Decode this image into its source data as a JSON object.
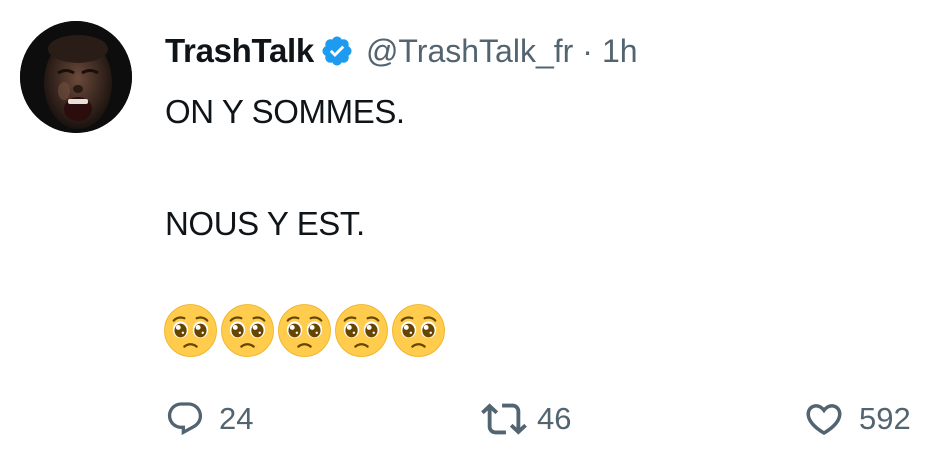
{
  "author": {
    "display_name": "TrashTalk",
    "handle": "@TrashTalk_fr",
    "separator": "·",
    "time": "1h",
    "avatar_icon": "avatar-photo-icon",
    "verified_color": "#1d9bf0"
  },
  "tweet": {
    "lines": [
      "ON Y SOMMES.",
      "NOUS Y EST."
    ],
    "emoji_icon": "pleading-face-emoji",
    "emoji_count": 5
  },
  "actions": {
    "replies": "24",
    "retweets": "46",
    "likes": "592",
    "icon_color": "#536471"
  }
}
